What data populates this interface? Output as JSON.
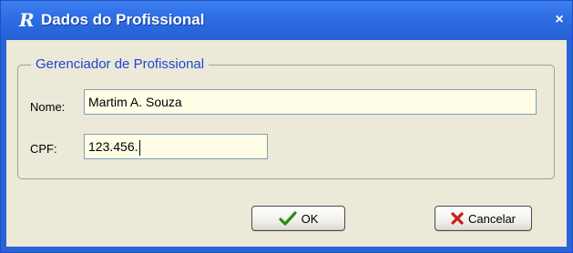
{
  "window": {
    "title": "Dados do Profissional",
    "app_icon_glyph": "R",
    "close_glyph": "×"
  },
  "group": {
    "legend": "Gerenciador de Profissional"
  },
  "form": {
    "nome_label": "Nome:",
    "nome_value": "Martim A. Souza",
    "cpf_label": "CPF:",
    "cpf_value": "123.456."
  },
  "buttons": {
    "ok_label": "OK",
    "cancel_label": "Cancelar"
  },
  "colors": {
    "titlebar": "#2f6ee6",
    "dialog_bg": "#ece9d8",
    "legend_text": "#1f44d6",
    "field_bg": "#fffde6",
    "ok_check": "#2f8a1a",
    "cancel_x": "#c81e1e"
  },
  "icons": {
    "ok": "checkmark-icon",
    "cancel": "x-icon"
  }
}
